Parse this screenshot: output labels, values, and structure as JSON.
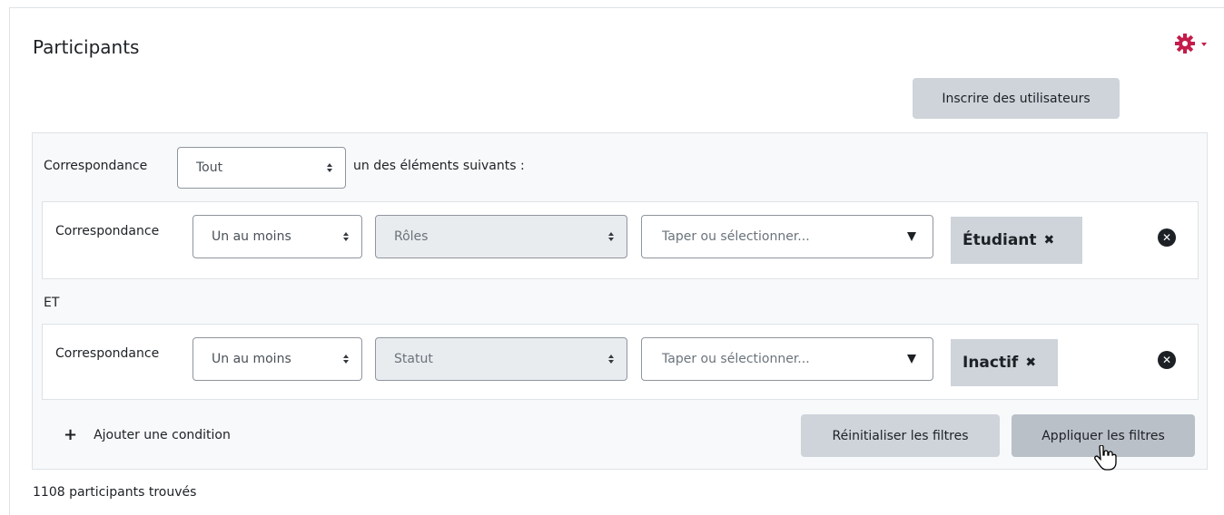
{
  "page": {
    "title": "Participants",
    "enrol_button": "Inscrire des utilisateurs",
    "result_count": "1108 participants trouvés",
    "colors": {
      "gear": "#c31c4b",
      "button_bg": "#ced4da",
      "apply_bg": "#b9c0c8"
    }
  },
  "filters": {
    "match_label": "Correspondance",
    "match_value": "Tout",
    "match_suffix": "un des éléments suivants :",
    "join_label": "ET",
    "rows": [
      {
        "label": "Correspondance",
        "match": "Un au moins",
        "type": "Rôles",
        "placeholder": "Taper ou sélectionner...",
        "tag": "Étudiant"
      },
      {
        "label": "Correspondance",
        "match": "Un au moins",
        "type": "Statut",
        "placeholder": "Taper ou sélectionner...",
        "tag": "Inactif"
      }
    ],
    "add_condition": "Ajouter une condition",
    "reset_button": "Réinitialiser les filtres",
    "apply_button": "Appliquer les filtres"
  },
  "icons": [
    "gear-icon",
    "chevron-down-icon",
    "sort-arrows-icon",
    "dropdown-triangle-icon",
    "remove-tag-icon",
    "remove-row-icon",
    "plus-icon",
    "hand-cursor-icon"
  ]
}
